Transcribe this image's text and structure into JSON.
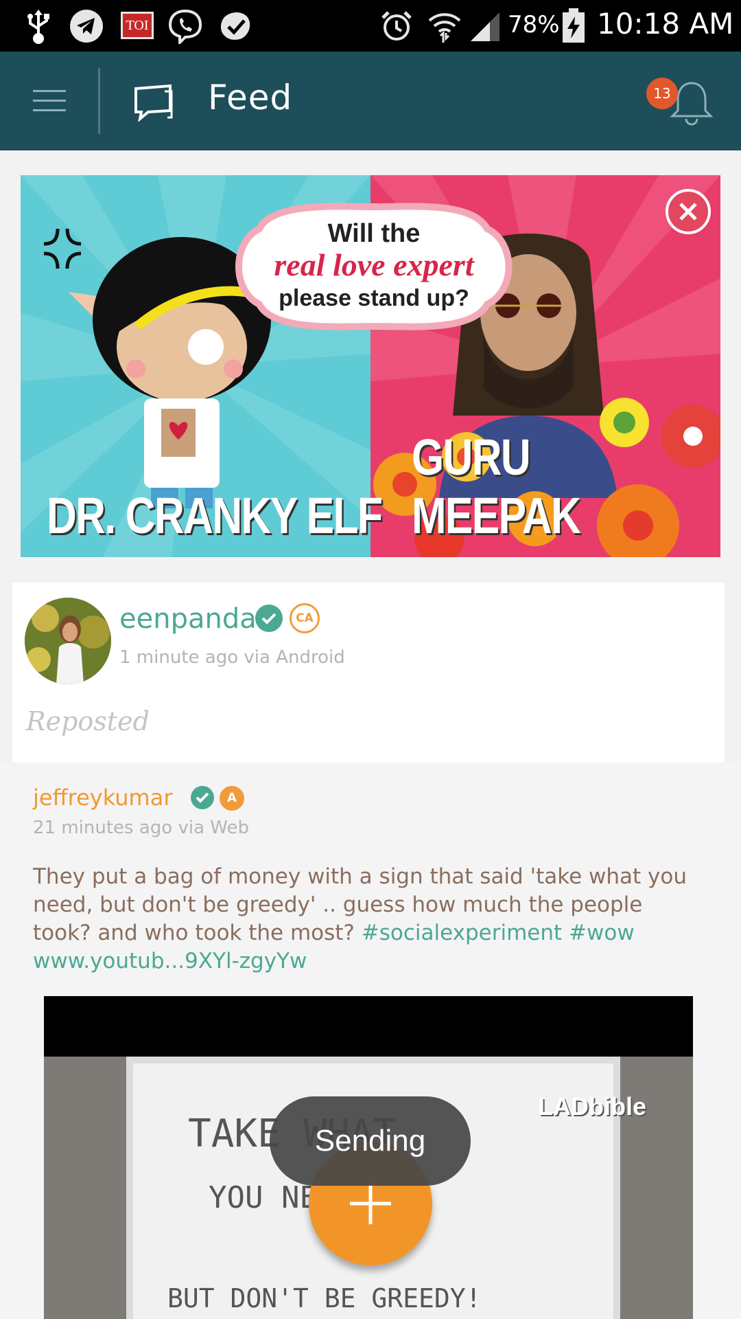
{
  "status_bar": {
    "battery": "78%",
    "time": "10:18 AM",
    "notification_icons": [
      "usb-icon",
      "telegram-icon",
      "toi-icon",
      "viber-icon",
      "check-icon"
    ],
    "toi_label": "TOI"
  },
  "toolbar": {
    "title": "Feed",
    "notification_count": "13"
  },
  "banner": {
    "headline_top": "Will the",
    "headline_middle": "real love expert",
    "headline_bottom": "please stand up?",
    "left_name": "DR. CRANKY ELF",
    "right_name": "GURU MEEPAK"
  },
  "post": {
    "username": "eenpanda",
    "level_badge": "CA",
    "meta": "1 minute ago via Android",
    "reposted_label": "Reposted",
    "original": {
      "username": "jeffreykumar",
      "level_badge": "A",
      "meta": "21 minutes ago via Web",
      "text_part1": "They put a bag of money with a sign that said 'take what you need, but don't be greedy' .. guess how much the people took? and who took the most?",
      "hashtag1": "#socialexperiment",
      "hashtag2": "#wow",
      "link": "www.youtub...9XYl-zgyYw"
    },
    "video": {
      "watermark": "LADbible",
      "sign_line1": "TAKE WHAT",
      "sign_line2": "YOU NEED...",
      "sign_line3": "BUT DON'T    BE GREEDY!"
    }
  },
  "toast": "Sending",
  "colors": {
    "toolbar": "#1d4e5a",
    "accent_green": "#4aa893",
    "accent_orange": "#f29529",
    "badge_red": "#e2582a"
  }
}
